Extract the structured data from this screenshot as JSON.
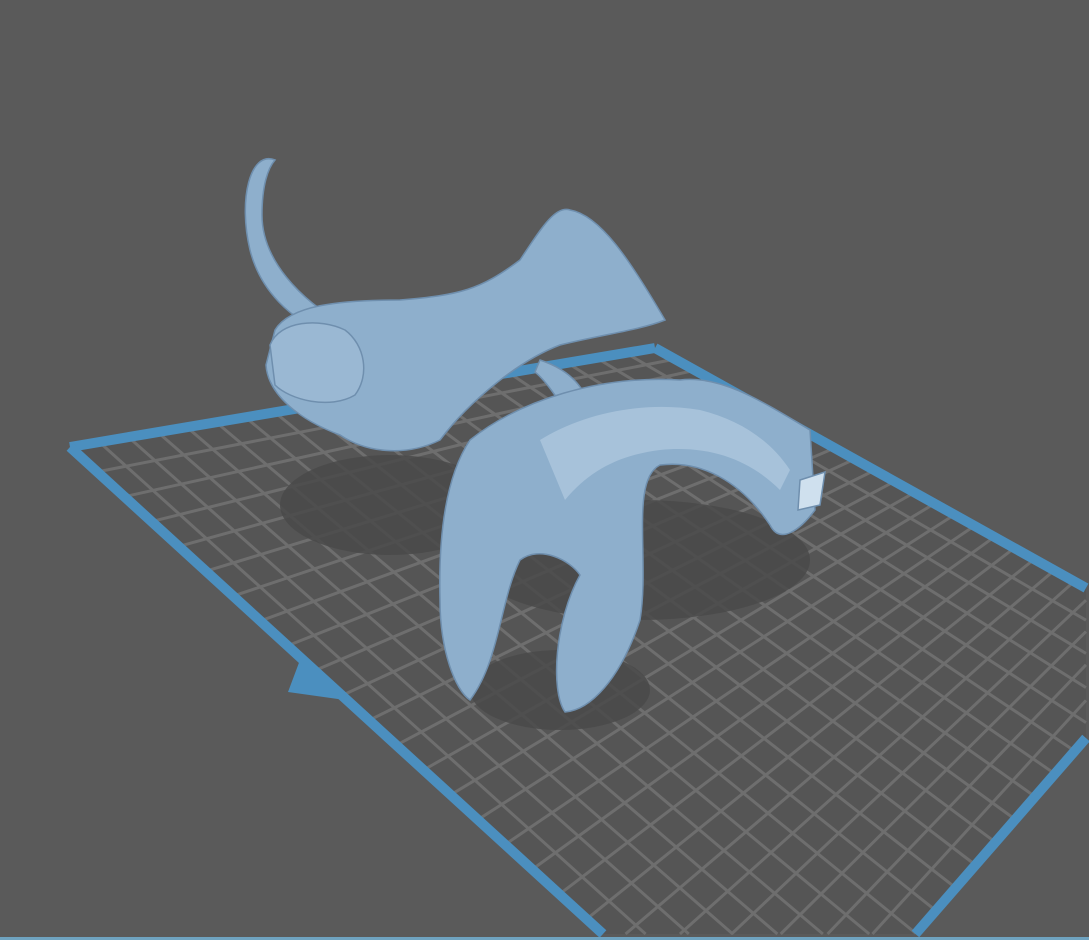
{
  "viewport": {
    "background_color": "#5a5a5a",
    "plate_border_color": "#4b8fbf",
    "grid_color": "#6e6e6e",
    "model_color": "#8eafcc",
    "shadow_color": "#4a4a4a"
  },
  "icons": [
    "build-plate",
    "plate-origin-marker-icon",
    "3d-model"
  ]
}
